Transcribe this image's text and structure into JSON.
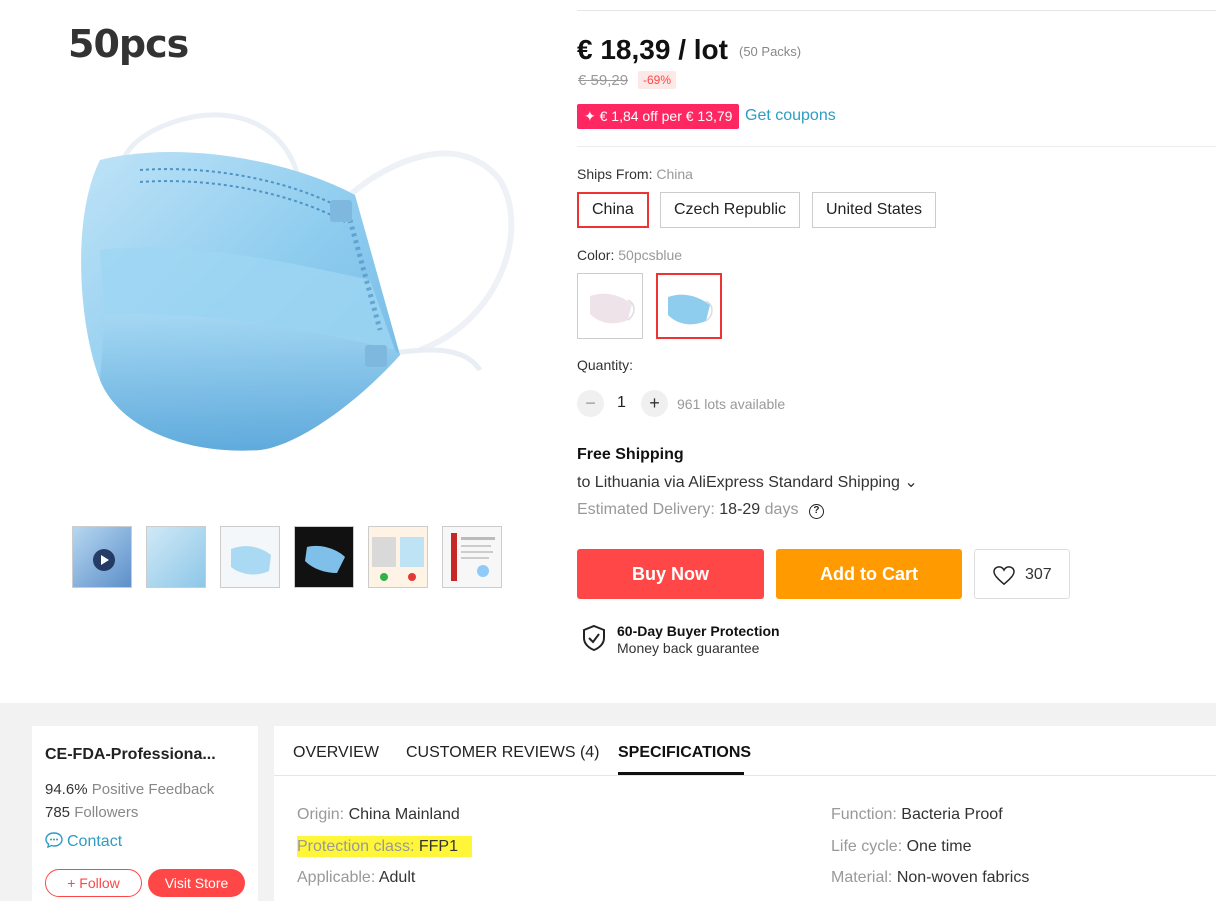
{
  "gallery": {
    "watermark": "50pcs",
    "thumbnails": [
      {
        "name": "video-thumb",
        "kind": "video"
      },
      {
        "name": "mask-closeup-thumb"
      },
      {
        "name": "mask-front-thumb"
      },
      {
        "name": "mask-hand-thumb"
      },
      {
        "name": "comparison-thumb"
      },
      {
        "name": "certificate-thumb"
      }
    ]
  },
  "pricing": {
    "price": "€ 18,39 / lot",
    "packs": "(50 Packs)",
    "old_price": "€ 59,29",
    "discount": "-69%",
    "coupon": "✦ € 1,84 off per € 13,79",
    "get_coupons": "Get coupons"
  },
  "ships_from": {
    "label": "Ships From:",
    "value": "China",
    "options": [
      "China",
      "Czech Republic",
      "United States"
    ],
    "selected": "China"
  },
  "color": {
    "label": "Color:",
    "value": "50pcsblue",
    "options": [
      "50pcs white",
      "50pcsblue"
    ],
    "selected_index": 1
  },
  "quantity": {
    "label": "Quantity:",
    "minus": "−",
    "plus": "+",
    "value": "1",
    "available": "961 lots available"
  },
  "shipping": {
    "title": "Free Shipping",
    "to": "to Lithuania via AliExpress Standard Shipping ⌄",
    "eta_label": "Estimated Delivery:",
    "eta_value": "18-29",
    "eta_unit": "days",
    "help": "?"
  },
  "actions": {
    "buy_now": "Buy Now",
    "add_to_cart": "Add to Cart",
    "wishlist_count": "307"
  },
  "protection": {
    "title": "60-Day Buyer Protection",
    "subtitle": "Money back guarantee"
  },
  "store": {
    "name": "CE-FDA-Professiona...",
    "feedback_value": "94.6%",
    "feedback_label": "Positive Feedback",
    "followers_value": "785",
    "followers_label": "Followers",
    "contact": "Contact",
    "follow": "+ Follow",
    "visit": "Visit Store"
  },
  "tabs": {
    "overview": "OVERVIEW",
    "reviews": "CUSTOMER REVIEWS (4)",
    "specs": "SPECIFICATIONS",
    "active": "SPECIFICATIONS"
  },
  "specs": {
    "left": [
      {
        "k": "Origin:",
        "v": "China Mainland"
      },
      {
        "k": "Protection class:",
        "v": "FFP1",
        "highlight": true
      },
      {
        "k": "Applicable:",
        "v": "Adult"
      }
    ],
    "right": [
      {
        "k": "Function:",
        "v": "Bacteria Proof"
      },
      {
        "k": "Life cycle:",
        "v": "One time"
      },
      {
        "k": "Material:",
        "v": "Non-woven fabrics"
      }
    ]
  },
  "colors": {
    "accent_red": "#ff4747",
    "accent_orange": "#ff9a00",
    "coupon_pink": "#ff2761",
    "link_blue": "#2e9cc3",
    "highlight_yellow": "#fff63a"
  }
}
